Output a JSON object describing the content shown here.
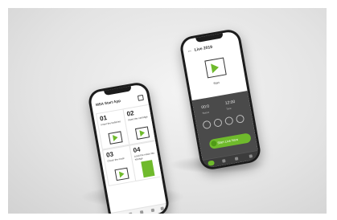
{
  "phone_left": {
    "app_title": "MSA Start App",
    "cards": [
      {
        "number": "01",
        "label": "Insert the batteries"
      },
      {
        "number": "02",
        "label": "Insert the cartridge"
      },
      {
        "number": "03",
        "label": "Check the mask"
      },
      {
        "number": "04",
        "label": "Load the mask into storage"
      }
    ]
  },
  "phone_right": {
    "title": "Live 2019",
    "item_label": "Start",
    "stats": [
      {
        "value": "00:0",
        "label": "Status"
      },
      {
        "value": "12:00",
        "label": "Time"
      }
    ],
    "start_button": "Start Live Now"
  },
  "colors": {
    "accent": "#6fba2c",
    "dark_panel": "#4a4a4a",
    "phone_frame": "#1c1c1c"
  }
}
